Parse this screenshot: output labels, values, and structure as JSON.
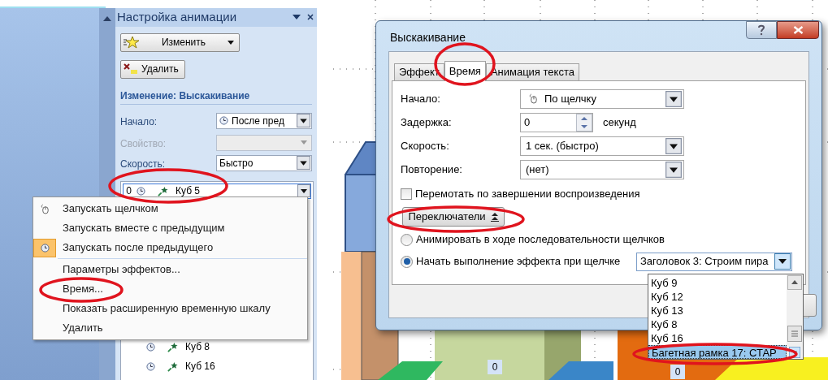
{
  "task_pane": {
    "title": "Настройка анимации",
    "change_button": "Изменить",
    "remove_button": "Удалить",
    "section_title": "Изменение: Выскакивание",
    "fields": [
      {
        "label": "Начало:",
        "value": "После пред",
        "disabled": false,
        "kind": "clock"
      },
      {
        "label": "Свойство:",
        "disabled": true,
        "kind": "plain"
      },
      {
        "label": "Скорость:",
        "value": "Быстро",
        "disabled": false,
        "kind": "plain"
      }
    ],
    "effects": [
      {
        "order": "0",
        "name": "Куб 5",
        "selected": true
      },
      {
        "name": "Куб 8",
        "selected": false
      },
      {
        "name": "Куб 16",
        "selected": false
      }
    ]
  },
  "context_menu": {
    "groups": [
      [
        {
          "label": "Запускать щелчком",
          "kind": "mouse",
          "checked": false
        },
        {
          "label": "Запускать вместе с предыдущим",
          "kind": "none",
          "checked": false
        },
        {
          "label": "Запускать после предыдущего",
          "kind": "clock",
          "checked": true
        }
      ],
      [
        {
          "label": "Параметры эффектов...",
          "kind": "none",
          "checked": false
        },
        {
          "label": "Время...",
          "kind": "none",
          "checked": false
        },
        {
          "label": "Показать расширенную временную шкалу",
          "kind": "none",
          "checked": false
        },
        {
          "label": "Удалить",
          "kind": "none",
          "checked": false
        }
      ]
    ]
  },
  "dialog": {
    "title": "Выскакивание",
    "tabs": [
      {
        "label": "Эффект",
        "selected": false
      },
      {
        "label": "Время",
        "selected": true
      },
      {
        "label": "Анимация текста",
        "selected": false
      }
    ],
    "rows": [
      {
        "label": "Начало:",
        "value": "По щелчку",
        "kind": "clickdropdown"
      },
      {
        "label": "Задержка:",
        "value": "0",
        "kind": "spinner",
        "unit": "секунд"
      },
      {
        "label": "Скорость:",
        "value": "1 сек. (быстро)",
        "kind": "dropdown"
      },
      {
        "label": "Повторение:",
        "value": "(нет)",
        "kind": "dropdown"
      }
    ],
    "rewind": {
      "label": "Перемотать по завершении воспроизведения",
      "checked": false
    },
    "triggers_button": "Переключатели",
    "radios": [
      {
        "label": "Анимировать в ходе последовательности щелчков",
        "selected": false
      },
      {
        "label": "Начать выполнение эффекта при щелчке",
        "selected": true
      }
    ],
    "trigger_dropdown": {
      "value": "Заголовок 3: Строим пира",
      "options": [
        {
          "label": "Куб 9",
          "selected": false
        },
        {
          "label": "Куб 12",
          "selected": false
        },
        {
          "label": "Куб 13",
          "selected": false
        },
        {
          "label": "Куб 8",
          "selected": false
        },
        {
          "label": "Куб 16",
          "selected": false
        },
        {
          "label": "Багетная рамка 17: СТАР",
          "selected": true
        }
      ]
    }
  },
  "slide_tags": [
    "0",
    "0"
  ]
}
